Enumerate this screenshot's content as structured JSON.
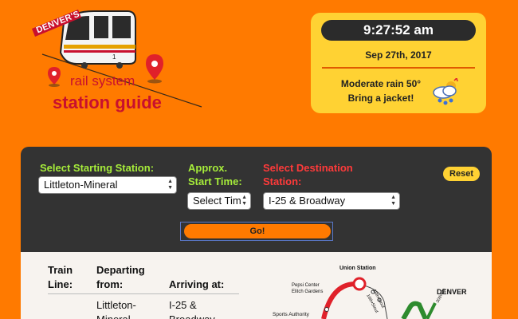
{
  "logo": {
    "badge": "DENVER'S",
    "line1": "rail system",
    "line2": "station guide"
  },
  "info": {
    "time": "9:27:52 am",
    "date": "Sep 27th, 2017",
    "weather_line1": "Moderate rain 50°",
    "weather_line2": "Bring a jacket!",
    "weather_icon": "rain-cloud-icon"
  },
  "form": {
    "start_label": "Select Starting Station:",
    "start_value": "Littleton-Mineral",
    "time_label_line1": "Approx.",
    "time_label_line2": "Start Time:",
    "time_value": "Select Tim",
    "dest_label_line1": "Select Destination",
    "dest_label_line2": "Station:",
    "dest_value": "I-25 & Broadway",
    "reset_label": "Reset",
    "go_label": "Go!"
  },
  "results": {
    "headers": {
      "line1": "Train",
      "line2": "Line:",
      "departing_line1": "Departing",
      "departing_line2": "from:",
      "arriving": "Arriving at:"
    },
    "row": {
      "departing_line1": "Littleton-",
      "departing_line2": "Mineral",
      "arriving_line1": "I-25 &",
      "arriving_line2": "Broadway"
    }
  },
  "map": {
    "union_station": "Union Station",
    "pepsi_line1": "Pepsi Center",
    "pepsi_line2": "Elitch Gardens",
    "sports_authority": "Sports Authority",
    "denver": "DENVER",
    "st18": "18th•Stout",
    "st16": "16th•Stout",
    "st30": "30th•Do"
  },
  "colors": {
    "background": "#ff7a00",
    "card": "#ffd233",
    "panel": "#333333",
    "green_label": "#a6ec3a",
    "red_label": "#ff3a3a",
    "logo_red": "#c8102e",
    "map_red": "#e0212a",
    "map_green": "#2e8b2e"
  }
}
